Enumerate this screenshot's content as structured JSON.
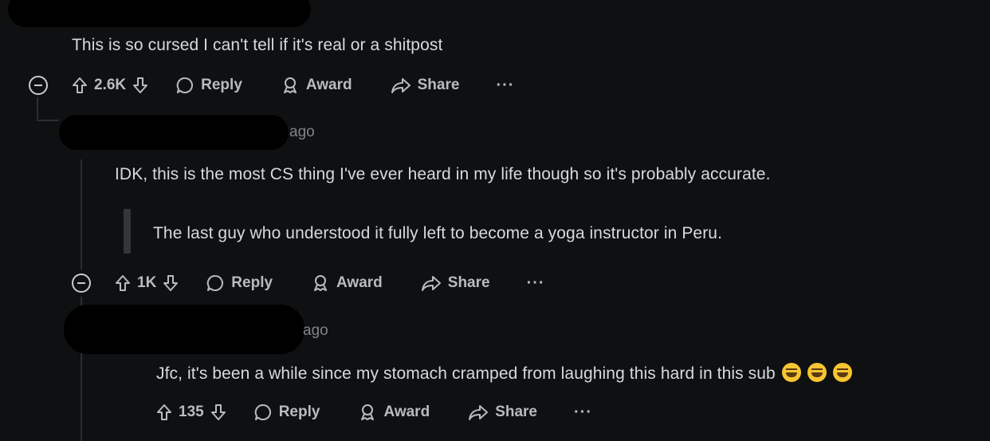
{
  "comments": [
    {
      "body": "This is so cursed I can't tell if it's real or a shitpost",
      "votes": "2.6K",
      "reply": "Reply",
      "award": "Award",
      "share": "Share",
      "more": "···"
    },
    {
      "time": "ago",
      "body": "IDK, this is the most CS thing I've ever heard in my life though so it's probably accurate.",
      "quote": "The last guy who understood it fully left to become a yoga instructor in Peru.",
      "votes": "1K",
      "reply": "Reply",
      "award": "Award",
      "share": "Share",
      "more": "···"
    },
    {
      "time": "ago",
      "body": "Jfc, it's been a while since my stomach cramped from laughing this hard in this sub",
      "emoji": [
        "rolling-on-floor-laughing",
        "rolling-on-floor-laughing",
        "rolling-on-floor-laughing"
      ],
      "votes": "135",
      "reply": "Reply",
      "award": "Award",
      "share": "Share",
      "more": "···"
    }
  ]
}
